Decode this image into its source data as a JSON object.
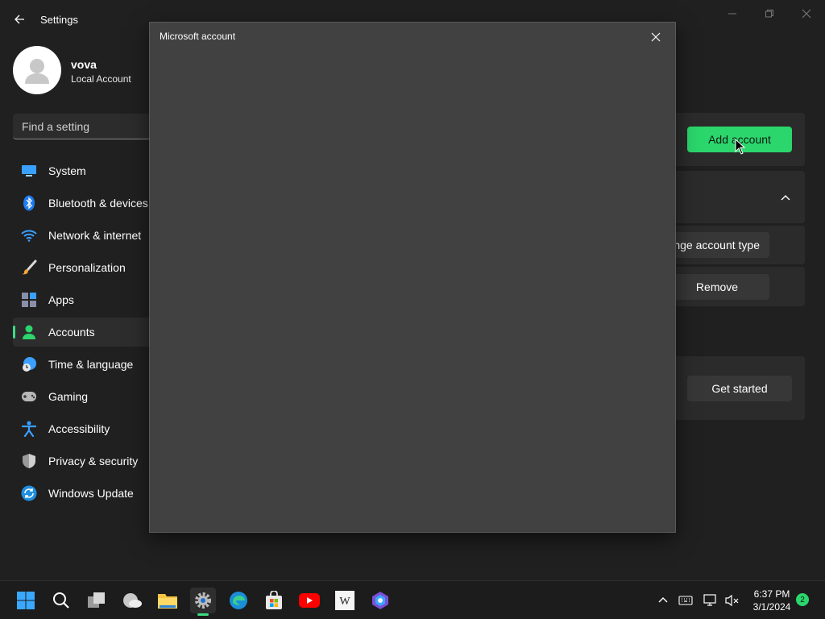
{
  "window": {
    "title": "Settings"
  },
  "profile": {
    "name": "vova",
    "account_type": "Local Account"
  },
  "search": {
    "placeholder": "Find a setting"
  },
  "nav": {
    "items": [
      {
        "label": "System",
        "icon": "monitor-icon"
      },
      {
        "label": "Bluetooth & devices",
        "icon": "bluetooth-icon"
      },
      {
        "label": "Network & internet",
        "icon": "wifi-icon"
      },
      {
        "label": "Personalization",
        "icon": "brush-icon"
      },
      {
        "label": "Apps",
        "icon": "apps-icon"
      },
      {
        "label": "Accounts",
        "icon": "person-icon",
        "active": true
      },
      {
        "label": "Time & language",
        "icon": "globe-clock-icon"
      },
      {
        "label": "Gaming",
        "icon": "gamepad-icon"
      },
      {
        "label": "Accessibility",
        "icon": "accessibility-icon"
      },
      {
        "label": "Privacy & security",
        "icon": "shield-icon"
      },
      {
        "label": "Windows Update",
        "icon": "update-icon"
      }
    ]
  },
  "content": {
    "add_account_label": "Add account",
    "change_type_label": "Change account type",
    "remove_label": "Remove",
    "get_started_label": "Get started"
  },
  "dialog": {
    "title": "Microsoft account"
  },
  "taskbar": {
    "time": "6:37 PM",
    "date": "3/1/2024",
    "notification_count": "2"
  },
  "colors": {
    "accent": "#2bd66c",
    "background": "#202020",
    "dialog_bg": "#414141"
  }
}
